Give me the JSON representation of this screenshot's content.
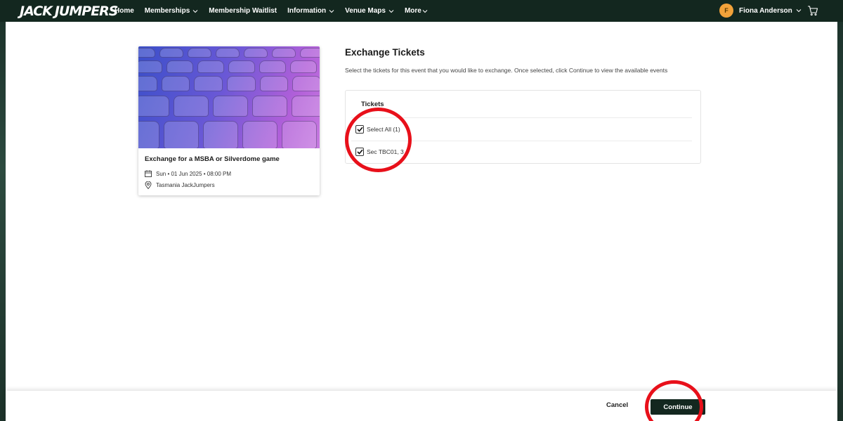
{
  "brand": {
    "logo_text_left": "JACK",
    "logo_text_right": "JUMPERS"
  },
  "nav": {
    "items": [
      {
        "label": "Home",
        "has_dropdown": false
      },
      {
        "label": "Memberships",
        "has_dropdown": true
      },
      {
        "label": "Membership Waitlist",
        "has_dropdown": false
      },
      {
        "label": "Information",
        "has_dropdown": true
      },
      {
        "label": "Venue Maps",
        "has_dropdown": true
      },
      {
        "label": "More",
        "has_dropdown": true
      }
    ]
  },
  "user": {
    "initial": "F",
    "name": "Fiona Anderson",
    "avatar_color": "#f2a23a"
  },
  "event": {
    "title": "Exchange for a MSBA or Silverdome game",
    "datetime": "Sun • 01 Jun 2025 • 08:00 PM",
    "venue": "Tasmania JackJumpers"
  },
  "exchange": {
    "title": "Exchange Tickets",
    "description": "Select the tickets for this event that you would like to exchange. Once selected, click Continue to view the available events",
    "tickets_header": "Tickets",
    "select_all": {
      "label": "Select All (1)",
      "checked": true
    },
    "tickets": [
      {
        "label": "Sec TBC01, 3",
        "checked": true
      }
    ]
  },
  "actions": {
    "cancel_label": "Cancel",
    "continue_label": "Continue"
  },
  "colors": {
    "brand_dark": "#13271f",
    "annotation": "#e8101a"
  }
}
